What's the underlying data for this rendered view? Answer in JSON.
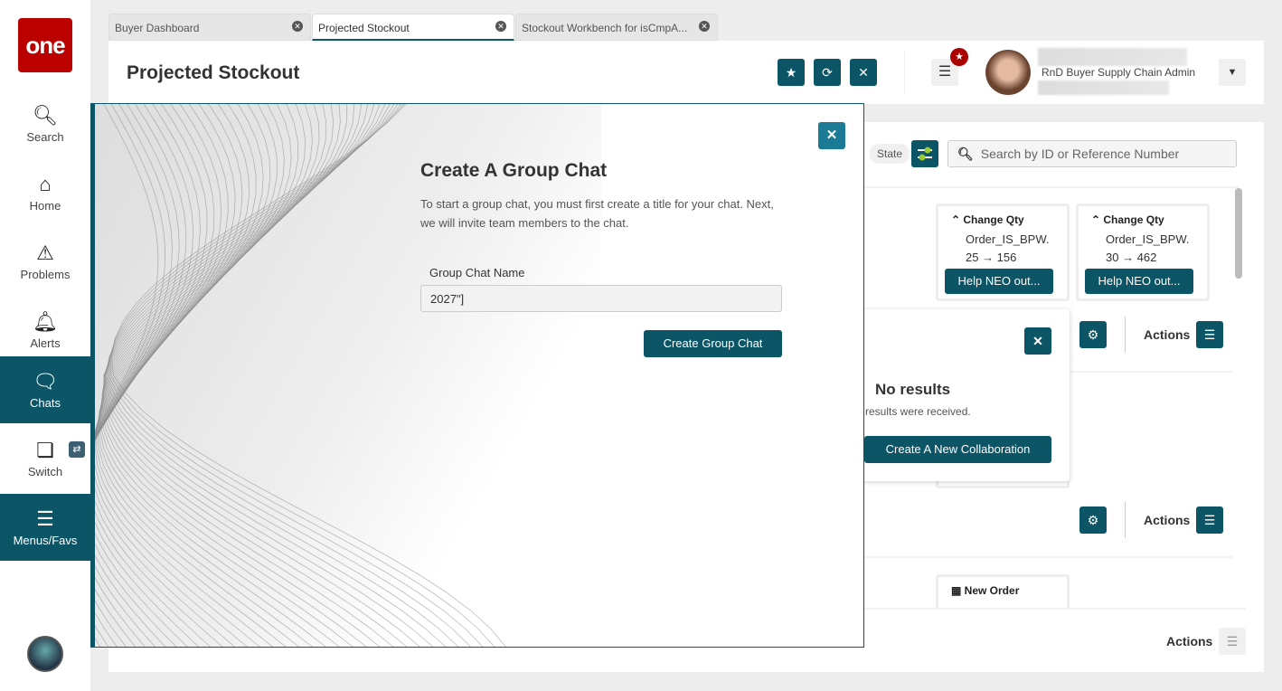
{
  "sidebar": {
    "logo": "one",
    "items": [
      {
        "label": "Search"
      },
      {
        "label": "Home"
      },
      {
        "label": "Problems"
      },
      {
        "label": "Alerts"
      },
      {
        "label": "Chats"
      },
      {
        "label": "Switch"
      },
      {
        "label": "Menus/Favs"
      }
    ]
  },
  "tabs": [
    {
      "label": "Buyer Dashboard"
    },
    {
      "label": "Projected Stockout"
    },
    {
      "label": "Stockout Workbench for isCmpA..."
    }
  ],
  "header": {
    "title": "Projected Stockout",
    "user_role": "RnD Buyer Supply Chain Admin"
  },
  "toolbar": {
    "state_chip": "State",
    "search_placeholder": "Search by ID or Reference Number"
  },
  "cards": [
    {
      "title": "Change Qty",
      "order": "Order_IS_BPW.",
      "change": "25 → 156",
      "button": "Help NEO out..."
    },
    {
      "title": "Change Qty",
      "order": "Order_IS_BPW.",
      "change": "30 → 462",
      "button": "Help NEO out..."
    },
    {
      "title": "New Order"
    }
  ],
  "actions_label": "Actions",
  "popup": {
    "title": "No results",
    "message": "results were received.",
    "button": "Create A New Collaboration"
  },
  "modal": {
    "title": "Create A Group Chat",
    "description": "To start a group chat, you must first create a title for your chat. Next, we will invite team members to the chat.",
    "field_label": "Group Chat Name",
    "field_value": "2027\"]",
    "submit": "Create Group Chat"
  },
  "colors": {
    "primary": "#0b5566",
    "logo": "#bb0000"
  }
}
